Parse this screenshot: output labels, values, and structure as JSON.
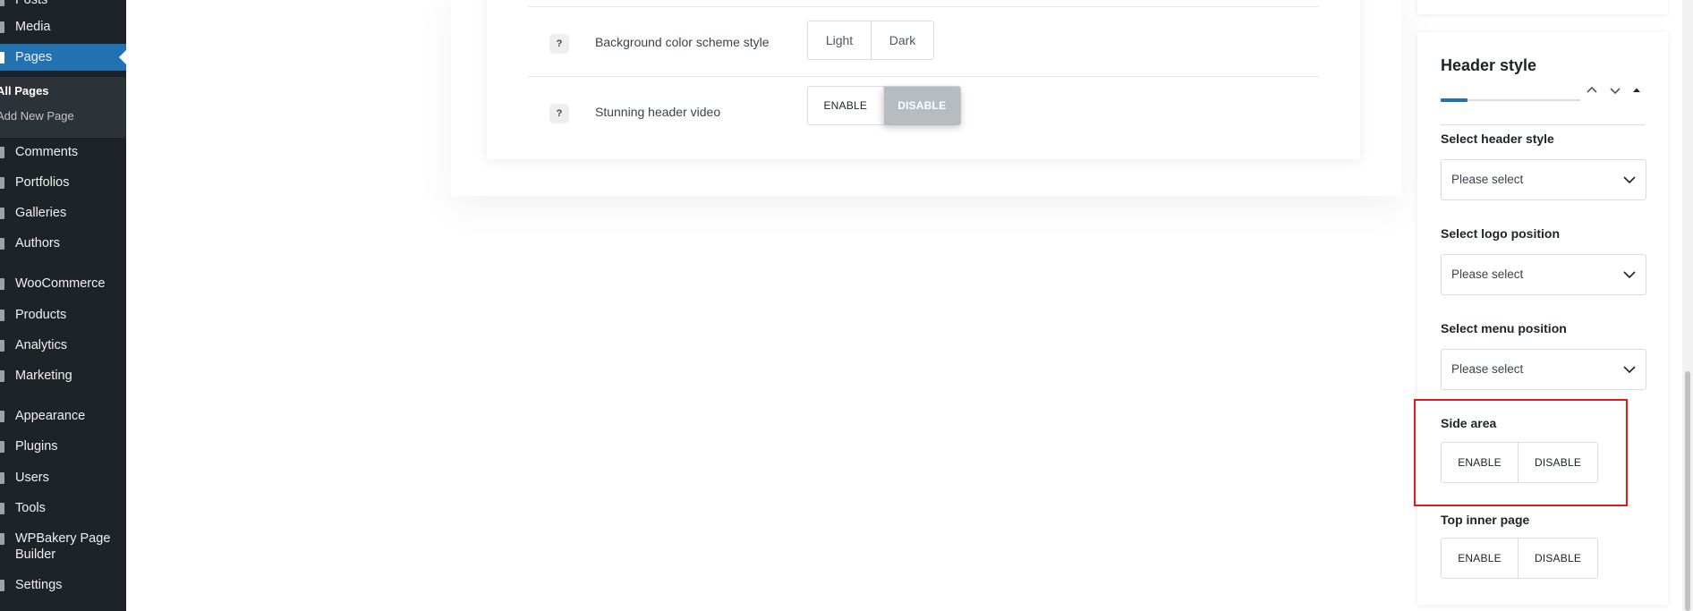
{
  "sidebar": {
    "items": [
      {
        "label": "Posts",
        "icon": "posts-icon"
      },
      {
        "label": "Media",
        "icon": "media-icon"
      },
      {
        "label": "Pages",
        "icon": "pages-icon"
      },
      {
        "label": "Comments",
        "icon": "comments-icon"
      },
      {
        "label": "Portfolios",
        "icon": "portfolios-icon"
      },
      {
        "label": "Galleries",
        "icon": "galleries-icon"
      },
      {
        "label": "Authors",
        "icon": "authors-icon"
      },
      {
        "label": "WooCommerce",
        "icon": "woocommerce-icon"
      },
      {
        "label": "Products",
        "icon": "products-icon"
      },
      {
        "label": "Analytics",
        "icon": "analytics-icon"
      },
      {
        "label": "Marketing",
        "icon": "marketing-icon"
      },
      {
        "label": "Appearance",
        "icon": "appearance-icon"
      },
      {
        "label": "Plugins",
        "icon": "plugins-icon"
      },
      {
        "label": "Users",
        "icon": "users-icon"
      },
      {
        "label": "Tools",
        "icon": "tools-icon"
      },
      {
        "label": "WPBakery Page Builder",
        "icon": "wpbakery-icon"
      },
      {
        "label": "Settings",
        "icon": "settings-icon"
      }
    ],
    "submenu": [
      "All Pages",
      "Add New Page"
    ],
    "active": "Pages",
    "current_submenu": "All Pages"
  },
  "main_panel": {
    "rows": [
      {
        "label": "Background color scheme style",
        "help": "?",
        "options": [
          "Light",
          "Dark"
        ]
      },
      {
        "label": "Stunning header video",
        "help": "?",
        "options": [
          "ENABLE",
          "DISABLE"
        ],
        "selected": "DISABLE"
      }
    ]
  },
  "side_panel": {
    "title": "Header style",
    "fields": [
      {
        "label": "Select header style",
        "value": "Please select"
      },
      {
        "label": "Select logo position",
        "value": "Please select"
      },
      {
        "label": "Select menu position",
        "value": "Please select"
      }
    ],
    "toggles": [
      {
        "label": "Side area",
        "options": [
          "ENABLE",
          "DISABLE"
        ]
      },
      {
        "label": "Top inner page",
        "options": [
          "ENABLE",
          "DISABLE"
        ]
      }
    ]
  },
  "colors": {
    "sidebar_bg": "#1d2327",
    "accent": "#2271b1",
    "highlight_border": "#e11b1b",
    "selected_option": "#b7bcc1"
  }
}
